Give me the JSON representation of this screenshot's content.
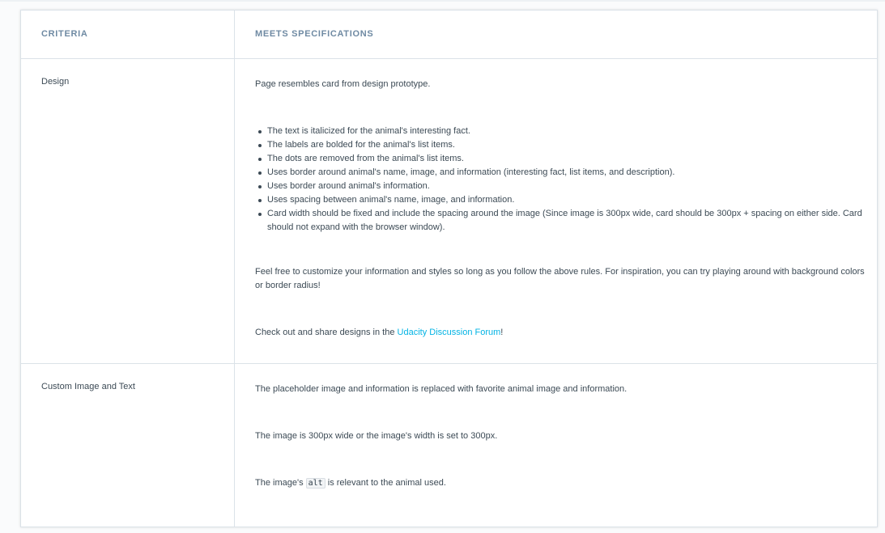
{
  "table": {
    "header": {
      "criteria": "CRITERIA",
      "meets": "MEETS SPECIFICATIONS"
    },
    "rows": [
      {
        "criteria": "Design",
        "intro": "Page resembles card from design prototype.",
        "bullets": [
          "The text is italicized for the animal's interesting fact.",
          "The labels are bolded for the animal's list items.",
          "The dots are removed from the animal's list items.",
          "Uses border around animal's name, image, and information (interesting fact, list items, and description).",
          "Uses border around animal's information.",
          "Uses spacing between animal's name, image, and information.",
          "Card width should be fixed and include the spacing around the image (Since image is 300px wide, card should be 300px + spacing on either side. Card should not expand with the browser window)."
        ],
        "note": "Feel free to customize your information and styles so long as you follow the above rules. For inspiration, you can try playing around with background colors or border radius!",
        "share_prefix": "Check out and share designs in the ",
        "share_link": "Udacity Discussion Forum",
        "share_suffix": "!"
      },
      {
        "criteria": "Custom Image and Text",
        "p1": "The placeholder image and information is replaced with favorite animal image and information.",
        "p2": "The image is 300px wide or the image's width is set to 300px.",
        "p3_prefix": "The image's ",
        "p3_code": "alt",
        "p3_suffix": " is relevant to the animal used."
      }
    ]
  },
  "colors": {
    "header_text": "#6f8aa3",
    "link": "#02b3e4",
    "border": "#dbe2e8"
  }
}
